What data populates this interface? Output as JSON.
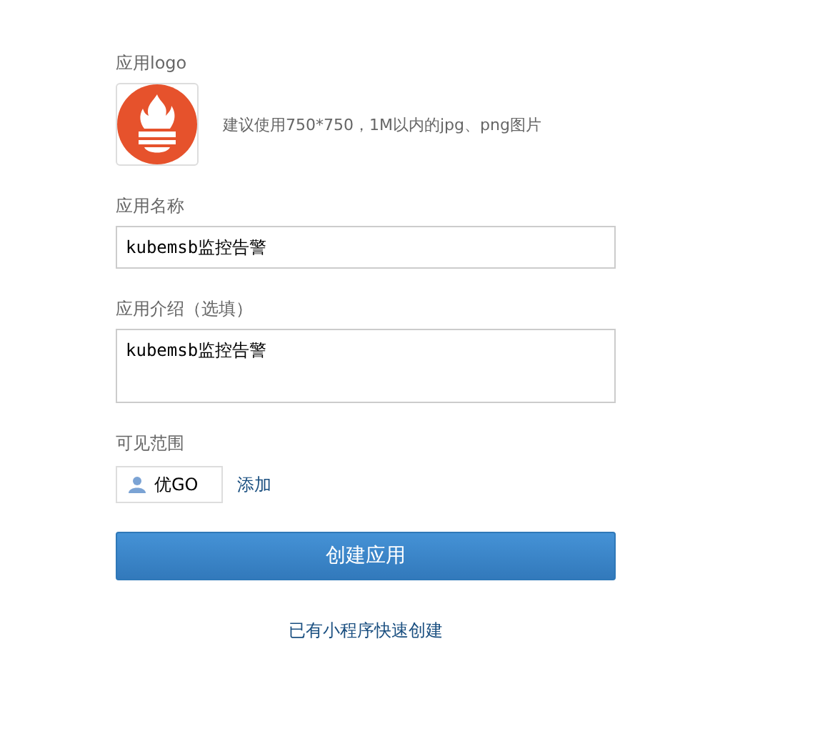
{
  "logo": {
    "label": "应用logo",
    "hint": "建议使用750*750，1M以内的jpg、png图片"
  },
  "name": {
    "label": "应用名称",
    "value": "kubemsb监控告警"
  },
  "intro": {
    "label": "应用介绍（选填）",
    "value": "kubemsb监控告警"
  },
  "visibility": {
    "label": "可见范围",
    "members": [
      {
        "name": "优GO"
      }
    ],
    "add_link": "添加"
  },
  "submit": "创建应用",
  "quick_create": "已有小程序快速创建"
}
